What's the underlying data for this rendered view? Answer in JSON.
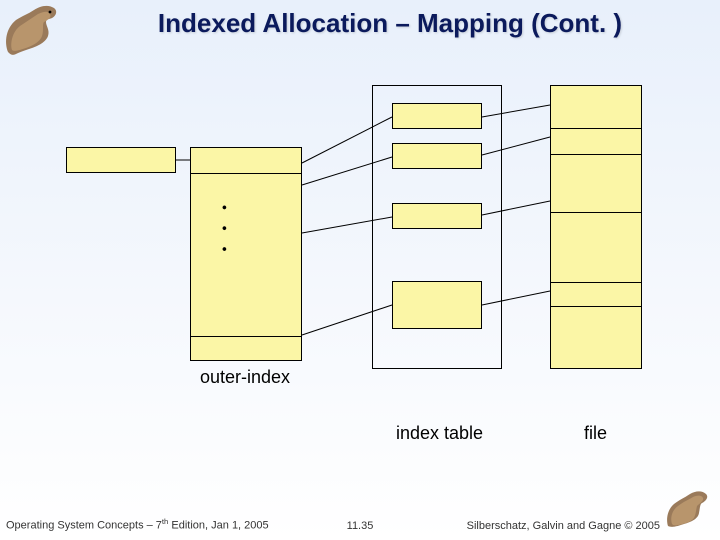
{
  "title": "Indexed Allocation – Mapping (Cont. )",
  "labels": {
    "outer_index": "outer-index",
    "index_table": "index table",
    "file": "file"
  },
  "footer": {
    "left_prefix": "Operating System Concepts – 7",
    "left_sup": "th",
    "left_suffix": " Edition, Jan 1, 2005",
    "center": "11.35",
    "right": "Silberschatz, Galvin and Gagne © 2005"
  },
  "icons": {
    "dino_left": "dinosaur-mascot-large",
    "dino_right": "dinosaur-mascot-small"
  },
  "ellipsis": "⋮"
}
